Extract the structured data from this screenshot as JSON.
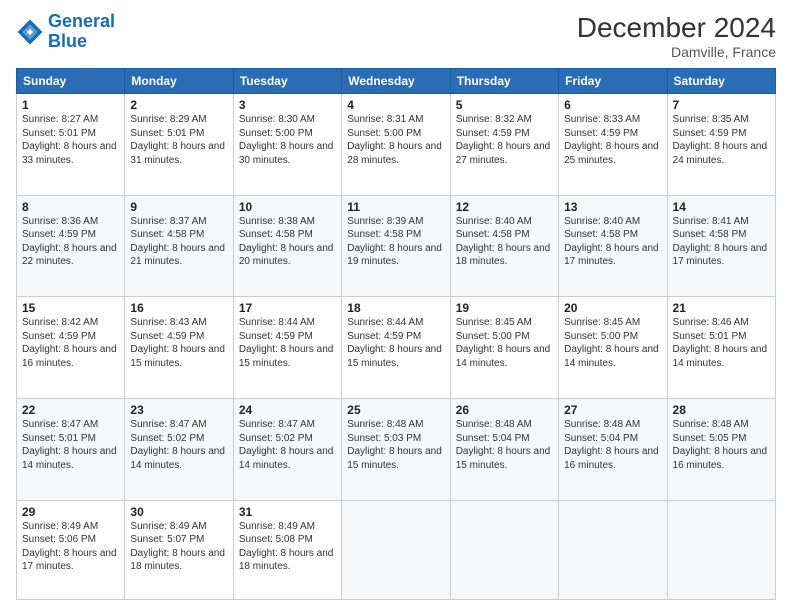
{
  "logo": {
    "line1": "General",
    "line2": "Blue"
  },
  "title": "December 2024",
  "location": "Damville, France",
  "days_of_week": [
    "Sunday",
    "Monday",
    "Tuesday",
    "Wednesday",
    "Thursday",
    "Friday",
    "Saturday"
  ],
  "weeks": [
    [
      {
        "day": "1",
        "sunrise": "8:27 AM",
        "sunset": "5:01 PM",
        "daylight": "8 hours and 33 minutes."
      },
      {
        "day": "2",
        "sunrise": "8:29 AM",
        "sunset": "5:01 PM",
        "daylight": "8 hours and 31 minutes."
      },
      {
        "day": "3",
        "sunrise": "8:30 AM",
        "sunset": "5:00 PM",
        "daylight": "8 hours and 30 minutes."
      },
      {
        "day": "4",
        "sunrise": "8:31 AM",
        "sunset": "5:00 PM",
        "daylight": "8 hours and 28 minutes."
      },
      {
        "day": "5",
        "sunrise": "8:32 AM",
        "sunset": "4:59 PM",
        "daylight": "8 hours and 27 minutes."
      },
      {
        "day": "6",
        "sunrise": "8:33 AM",
        "sunset": "4:59 PM",
        "daylight": "8 hours and 25 minutes."
      },
      {
        "day": "7",
        "sunrise": "8:35 AM",
        "sunset": "4:59 PM",
        "daylight": "8 hours and 24 minutes."
      }
    ],
    [
      {
        "day": "8",
        "sunrise": "8:36 AM",
        "sunset": "4:59 PM",
        "daylight": "8 hours and 22 minutes."
      },
      {
        "day": "9",
        "sunrise": "8:37 AM",
        "sunset": "4:58 PM",
        "daylight": "8 hours and 21 minutes."
      },
      {
        "day": "10",
        "sunrise": "8:38 AM",
        "sunset": "4:58 PM",
        "daylight": "8 hours and 20 minutes."
      },
      {
        "day": "11",
        "sunrise": "8:39 AM",
        "sunset": "4:58 PM",
        "daylight": "8 hours and 19 minutes."
      },
      {
        "day": "12",
        "sunrise": "8:40 AM",
        "sunset": "4:58 PM",
        "daylight": "8 hours and 18 minutes."
      },
      {
        "day": "13",
        "sunrise": "8:40 AM",
        "sunset": "4:58 PM",
        "daylight": "8 hours and 17 minutes."
      },
      {
        "day": "14",
        "sunrise": "8:41 AM",
        "sunset": "4:58 PM",
        "daylight": "8 hours and 17 minutes."
      }
    ],
    [
      {
        "day": "15",
        "sunrise": "8:42 AM",
        "sunset": "4:59 PM",
        "daylight": "8 hours and 16 minutes."
      },
      {
        "day": "16",
        "sunrise": "8:43 AM",
        "sunset": "4:59 PM",
        "daylight": "8 hours and 15 minutes."
      },
      {
        "day": "17",
        "sunrise": "8:44 AM",
        "sunset": "4:59 PM",
        "daylight": "8 hours and 15 minutes."
      },
      {
        "day": "18",
        "sunrise": "8:44 AM",
        "sunset": "4:59 PM",
        "daylight": "8 hours and 15 minutes."
      },
      {
        "day": "19",
        "sunrise": "8:45 AM",
        "sunset": "5:00 PM",
        "daylight": "8 hours and 14 minutes."
      },
      {
        "day": "20",
        "sunrise": "8:45 AM",
        "sunset": "5:00 PM",
        "daylight": "8 hours and 14 minutes."
      },
      {
        "day": "21",
        "sunrise": "8:46 AM",
        "sunset": "5:01 PM",
        "daylight": "8 hours and 14 minutes."
      }
    ],
    [
      {
        "day": "22",
        "sunrise": "8:47 AM",
        "sunset": "5:01 PM",
        "daylight": "8 hours and 14 minutes."
      },
      {
        "day": "23",
        "sunrise": "8:47 AM",
        "sunset": "5:02 PM",
        "daylight": "8 hours and 14 minutes."
      },
      {
        "day": "24",
        "sunrise": "8:47 AM",
        "sunset": "5:02 PM",
        "daylight": "8 hours and 14 minutes."
      },
      {
        "day": "25",
        "sunrise": "8:48 AM",
        "sunset": "5:03 PM",
        "daylight": "8 hours and 15 minutes."
      },
      {
        "day": "26",
        "sunrise": "8:48 AM",
        "sunset": "5:04 PM",
        "daylight": "8 hours and 15 minutes."
      },
      {
        "day": "27",
        "sunrise": "8:48 AM",
        "sunset": "5:04 PM",
        "daylight": "8 hours and 16 minutes."
      },
      {
        "day": "28",
        "sunrise": "8:48 AM",
        "sunset": "5:05 PM",
        "daylight": "8 hours and 16 minutes."
      }
    ],
    [
      {
        "day": "29",
        "sunrise": "8:49 AM",
        "sunset": "5:06 PM",
        "daylight": "8 hours and 17 minutes."
      },
      {
        "day": "30",
        "sunrise": "8:49 AM",
        "sunset": "5:07 PM",
        "daylight": "8 hours and 18 minutes."
      },
      {
        "day": "31",
        "sunrise": "8:49 AM",
        "sunset": "5:08 PM",
        "daylight": "8 hours and 18 minutes."
      },
      null,
      null,
      null,
      null
    ]
  ]
}
